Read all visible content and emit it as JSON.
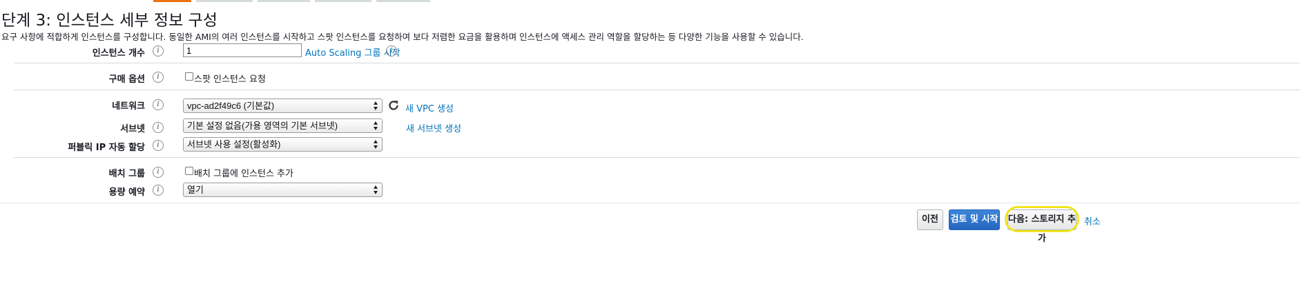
{
  "colors": {
    "tab_active": "#ec7211",
    "tab_inactive": "#d5dbdb",
    "link": "#0073bb",
    "primary_button": "#2a6fc9",
    "highlight_ring": "#f2e41c"
  },
  "header": {
    "title": "단계 3: 인스턴스 세부 정보 구성",
    "description": "요구 사항에 적합하게 인스턴스를 구성합니다. 동일한 AMI의 여러 인스턴스를 시작하고 스팟 인스턴스를 요청하여 보다 저렴한 요금을 활용하며 인스턴스에 액세스 관리 역할을 할당하는 등 다양한 기능을 사용할 수 있습니다."
  },
  "form": {
    "instance_count": {
      "label": "인스턴스 개수",
      "value": "1",
      "link": "Auto Scaling 그룹 시작"
    },
    "purchase_option": {
      "label": "구매 옵션",
      "checkbox_label": "스팟 인스턴스 요청"
    },
    "network": {
      "label": "네트워크",
      "value": "vpc-ad2f49c6 (기본값)",
      "link": "새 VPC 생성"
    },
    "subnet": {
      "label": "서브넷",
      "value": "기본 설정 없음(가용 영역의 기본 서브넷)",
      "link": "새 서브넷 생성"
    },
    "public_ip": {
      "label": "퍼블릭 IP 자동 할당",
      "value": "서브넷 사용 설정(활성화)"
    },
    "placement_group": {
      "label": "배치 그룹",
      "checkbox_label": "배치 그룹에 인스턴스 추가"
    },
    "capacity_reservation": {
      "label": "용량 예약",
      "value": "열기"
    },
    "info_glyph": "i"
  },
  "footer": {
    "cancel": "취소",
    "previous": "이전",
    "review_launch": "검토 및 시작",
    "next": "다음: 스토리지 추가"
  }
}
